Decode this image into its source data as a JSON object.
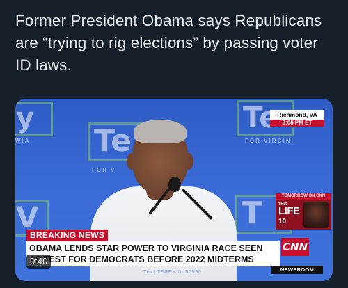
{
  "tweet": {
    "text": "Former President Obama says Republicans are “trying to rig elections” by passing voter ID laws."
  },
  "video": {
    "duration": "0:40",
    "background_signs": [
      "y",
      "Te",
      "Te",
      "T",
      "V"
    ],
    "sign_sublines": [
      "FOR VIRGINI",
      "FOR V",
      "WIA"
    ],
    "location": "Richmond, VA",
    "time": "3:06 PM ET",
    "promo": {
      "header": "TOMORROW ON CNN",
      "this": "THIS",
      "life": "LIFE",
      "time": "10"
    },
    "breaking_label": "BREAKING NEWS",
    "headline_lines": [
      "OBAMA LENDS STAR POWER TO VIRGINIA RACE SEEN",
      "AS TEST FOR DEMOCRATS BEFORE 2022 MIDTERMS"
    ],
    "network_logo": "CNN",
    "program": "NEWSROOM",
    "text_prompt": "Text TERRY to 50550"
  }
}
